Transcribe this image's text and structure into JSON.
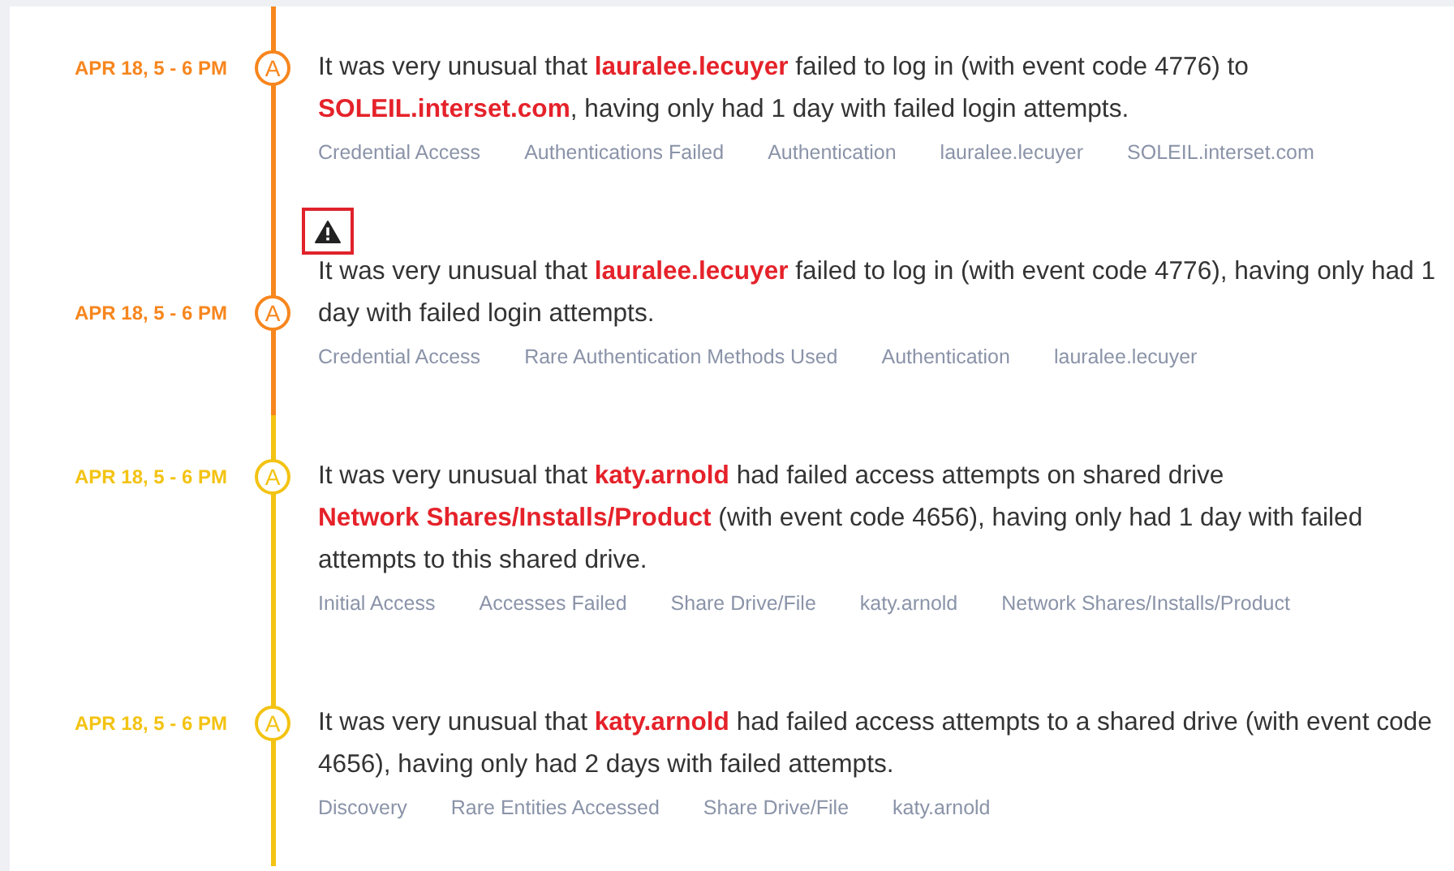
{
  "events": [
    {
      "time": "APR 18, 5 - 6 PM",
      "badge": "A",
      "color": "#f7861e",
      "warning": false,
      "description": "It was very unusual that **lauralee.lecuyer** failed to log in (with event code 4776) to **SOLEIL.interset.com**, having only had 1 day with failed login attempts.",
      "tags": [
        "Credential Access",
        "Authentications Failed",
        "Authentication",
        "lauralee.lecuyer",
        "SOLEIL.interset.com"
      ]
    },
    {
      "time": "APR 18, 5 - 6 PM",
      "badge": "A",
      "color": "#f7861e",
      "warning": true,
      "description": "It was very unusual that **lauralee.lecuyer** failed to log in (with event code 4776), having only had 1 day with failed login attempts.",
      "tags": [
        "Credential Access",
        "Rare Authentication Methods Used",
        "Authentication",
        "lauralee.lecuyer"
      ]
    },
    {
      "time": "APR 18, 5 - 6 PM",
      "badge": "A",
      "color": "#f3c313",
      "warning": false,
      "description": "It was very unusual that **katy.arnold** had failed access attempts on shared drive **Network Shares/Installs/Product** (with event code 4656), having only had 1 day with failed attempts to this shared drive.",
      "tags": [
        "Initial Access",
        "Accesses Failed",
        "Share Drive/File",
        "katy.arnold",
        "Network Shares/Installs/Product"
      ]
    },
    {
      "time": "APR 18, 5 - 6 PM",
      "badge": "A",
      "color": "#f3c313",
      "warning": false,
      "description": "It was very unusual that **katy.arnold** had failed access attempts to a shared drive (with event code 4656), having only had 2 days with failed attempts.",
      "tags": [
        "Discovery",
        "Rare Entities Accessed",
        "Share Drive/File",
        "katy.arnold"
      ]
    }
  ]
}
